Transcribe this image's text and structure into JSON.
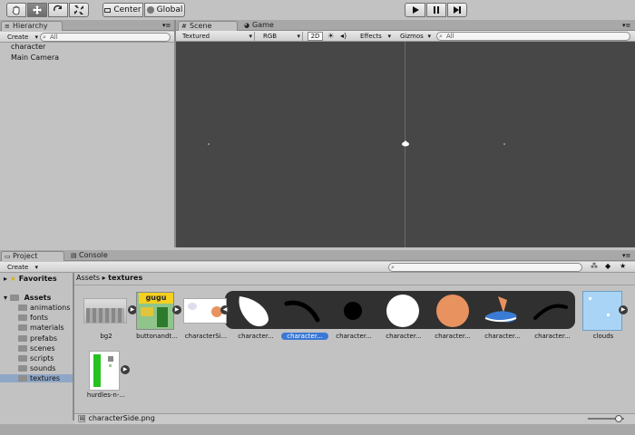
{
  "toolbar": {
    "tools": [
      "hand-tool",
      "move-tool",
      "rotate-tool",
      "scale-tool"
    ],
    "pivot_label": "Center",
    "space_label": "Global"
  },
  "hierarchy": {
    "tab_label": "Hierarchy",
    "create_label": "Create",
    "search_placeholder": "All",
    "items": [
      "character",
      "Main Camera"
    ]
  },
  "scene": {
    "tab_label": "Scene",
    "game_tab_label": "Game",
    "shading_mode": "Textured",
    "render_mode": "RGB",
    "mode_2d": "2D",
    "effects_label": "Effects",
    "gizmos_label": "Gizmos",
    "search_placeholder": "All",
    "background_color": "#474747"
  },
  "project": {
    "tab_label": "Project",
    "console_tab_label": "Console",
    "create_label": "Create",
    "favorites_label": "Favorites",
    "assets_label": "Assets",
    "folders": [
      "animations",
      "fonts",
      "materials",
      "prefabs",
      "scenes",
      "scripts",
      "sounds",
      "textures"
    ],
    "selected_folder": "textures",
    "breadcrumb": [
      "Assets",
      "textures"
    ],
    "assets": [
      {
        "label": "bg2"
      },
      {
        "label": "buttonandt..."
      },
      {
        "label": "characterSi..."
      },
      {
        "label": "character..."
      },
      {
        "label": "character...",
        "selected": true
      },
      {
        "label": "character..."
      },
      {
        "label": "character..."
      },
      {
        "label": "character..."
      },
      {
        "label": "character..."
      },
      {
        "label": "character..."
      },
      {
        "label": "clouds"
      },
      {
        "label": "hurdles-n-..."
      }
    ],
    "thumb_text": "gugu",
    "status_file": "characterSide.png"
  },
  "colors": {
    "accent_selection": "#3a78d4",
    "folder_selected": "#8ea7c7",
    "orange_circle": "#e8925f",
    "shoe_blue": "#3a7bd5",
    "clouds_bg": "#a9d4f5",
    "hurdle_green": "#27c21f"
  }
}
